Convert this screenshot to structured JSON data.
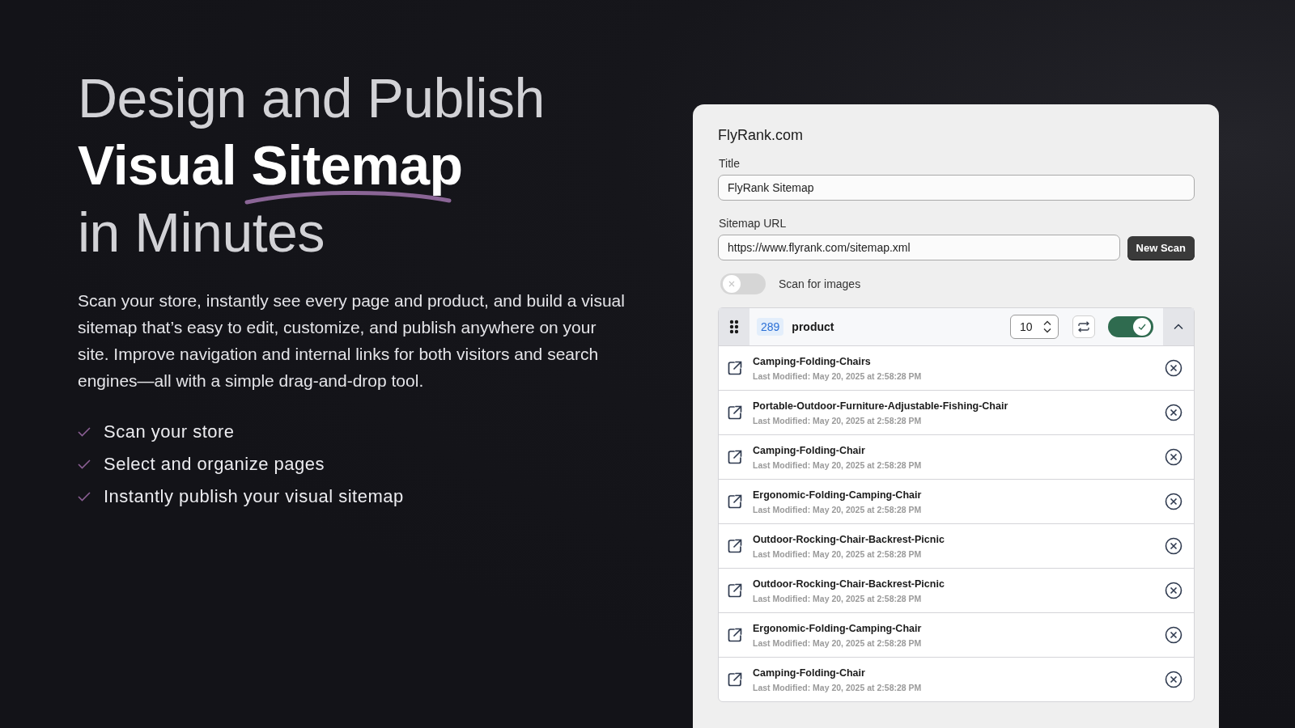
{
  "hero": {
    "headline": [
      {
        "kind": "light",
        "text": "Design and Publish"
      },
      {
        "kind": "bold",
        "text": "Visual",
        "underlined": "Sitemap"
      },
      {
        "kind": "light",
        "text": "in Minutes"
      }
    ],
    "description": "Scan your store, instantly see every page and product, and build a visual sitemap that’s easy to edit, customize, and publish anywhere on your site. Improve navigation and internal links for both visitors and search engines—all with a simple drag-and-drop tool.",
    "features": [
      "Scan your store",
      "Select and organize pages",
      "Instantly publish your visual sitemap"
    ]
  },
  "panel": {
    "site": "FlyRank.com",
    "title_field": {
      "label": "Title",
      "value": "FlyRank Sitemap"
    },
    "url_field": {
      "label": "Sitemap URL",
      "value": "https://www.flyrank.com/sitemap.xml"
    },
    "scan_button": "New Scan",
    "scan_images": {
      "label": "Scan for images",
      "on": false
    },
    "group": {
      "count": "289",
      "name": "product",
      "per_page": "10",
      "on": true,
      "expanded": true,
      "items": [
        {
          "title": "Camping-Folding-Chairs",
          "modified": "Last Modified: May 20, 2025 at 2:58:28 PM"
        },
        {
          "title": "Portable-Outdoor-Furniture-Adjustable-Fishing-Chair",
          "modified": "Last Modified: May 20, 2025 at 2:58:28 PM"
        },
        {
          "title": "Camping-Folding-Chair",
          "modified": "Last Modified: May 20, 2025 at 2:58:28 PM"
        },
        {
          "title": "Ergonomic-Folding-Camping-Chair",
          "modified": "Last Modified: May 20, 2025 at 2:58:28 PM"
        },
        {
          "title": "Outdoor-Rocking-Chair-Backrest-Picnic",
          "modified": "Last Modified: May 20, 2025 at 2:58:28 PM"
        },
        {
          "title": "Outdoor-Rocking-Chair-Backrest-Picnic",
          "modified": "Last Modified: May 20, 2025 at 2:58:28 PM"
        },
        {
          "title": "Ergonomic-Folding-Camping-Chair",
          "modified": "Last Modified: May 20, 2025 at 2:58:28 PM"
        },
        {
          "title": "Camping-Folding-Chair",
          "modified": "Last Modified: May 20, 2025 at 2:58:28 PM"
        }
      ]
    }
  }
}
